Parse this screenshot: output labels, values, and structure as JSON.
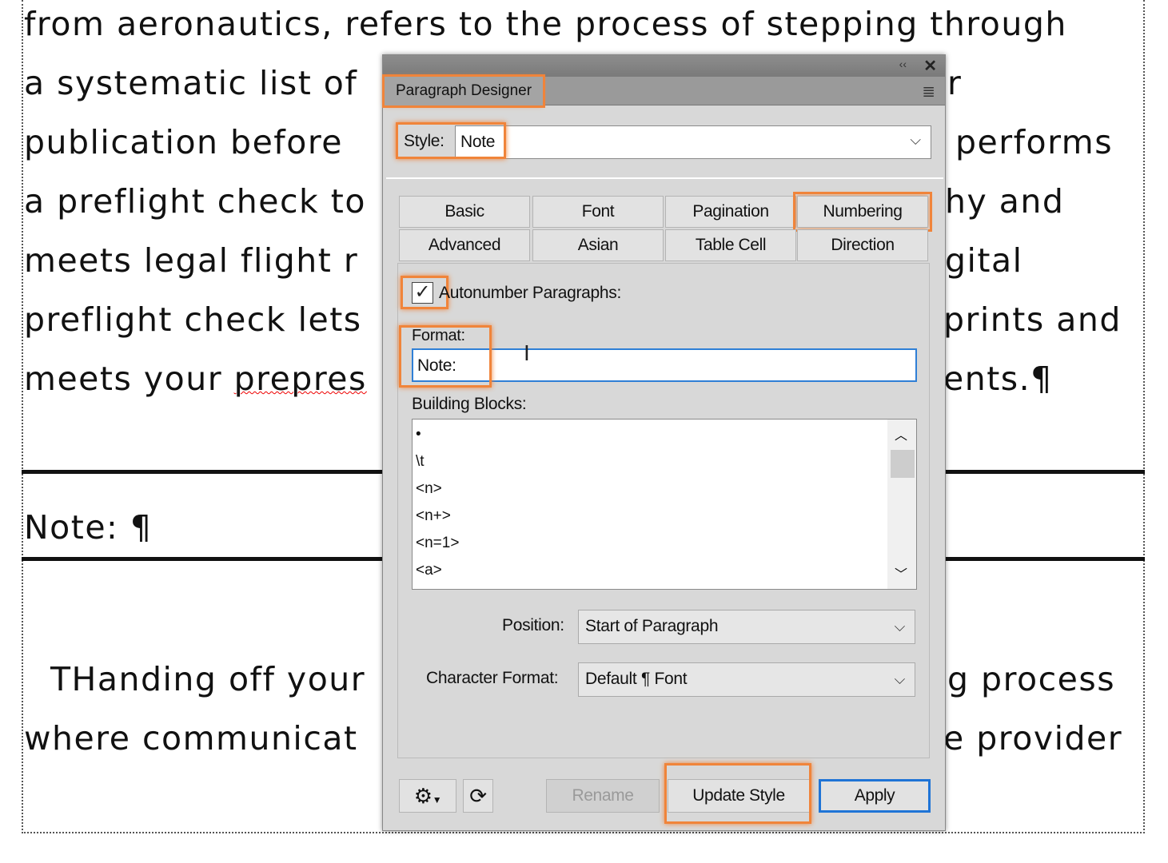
{
  "document": {
    "lines_left": [
      "from aeronautics, refers to the process of stepping through",
      "a systematic list of",
      "publication before",
      "a preflight check to",
      "meets legal flight r",
      "preflight check lets",
      "meets your prepres"
    ],
    "lines_right": [
      "",
      "r",
      "performs",
      "hy and",
      "gital",
      "prints and",
      "ents.¶"
    ],
    "note_para": "Note: ¶",
    "para2_left": [
      "THanding off your",
      "where communicat"
    ],
    "para2_right": [
      "g process",
      "e provider"
    ]
  },
  "panel": {
    "title": "Paragraph Designer",
    "style_label": "Style:",
    "style_value": "Note",
    "tabs": [
      "Basic",
      "Font",
      "Pagination",
      "Numbering",
      "Advanced",
      "Asian",
      "Table Cell",
      "Direction"
    ],
    "active_tab": "Numbering",
    "autonumber_label": "Autonumber Paragraphs:",
    "autonumber_checked": true,
    "format_label": "Format:",
    "format_value": "Note:",
    "building_blocks_label": "Building Blocks:",
    "building_blocks": [
      "•",
      "\\t",
      "<n>",
      "<n+>",
      "<n=1>",
      "<a>"
    ],
    "position_label": "Position:",
    "position_value": "Start of Paragraph",
    "char_format_label": "Character Format:",
    "char_format_value": "Default ¶ Font",
    "rename": "Rename",
    "update_style": "Update Style",
    "apply": "Apply",
    "highlight_color": "#f0843a",
    "icons": [
      "collapse-icon",
      "close-icon",
      "menu-icon",
      "gear-icon",
      "refresh-icon"
    ]
  }
}
